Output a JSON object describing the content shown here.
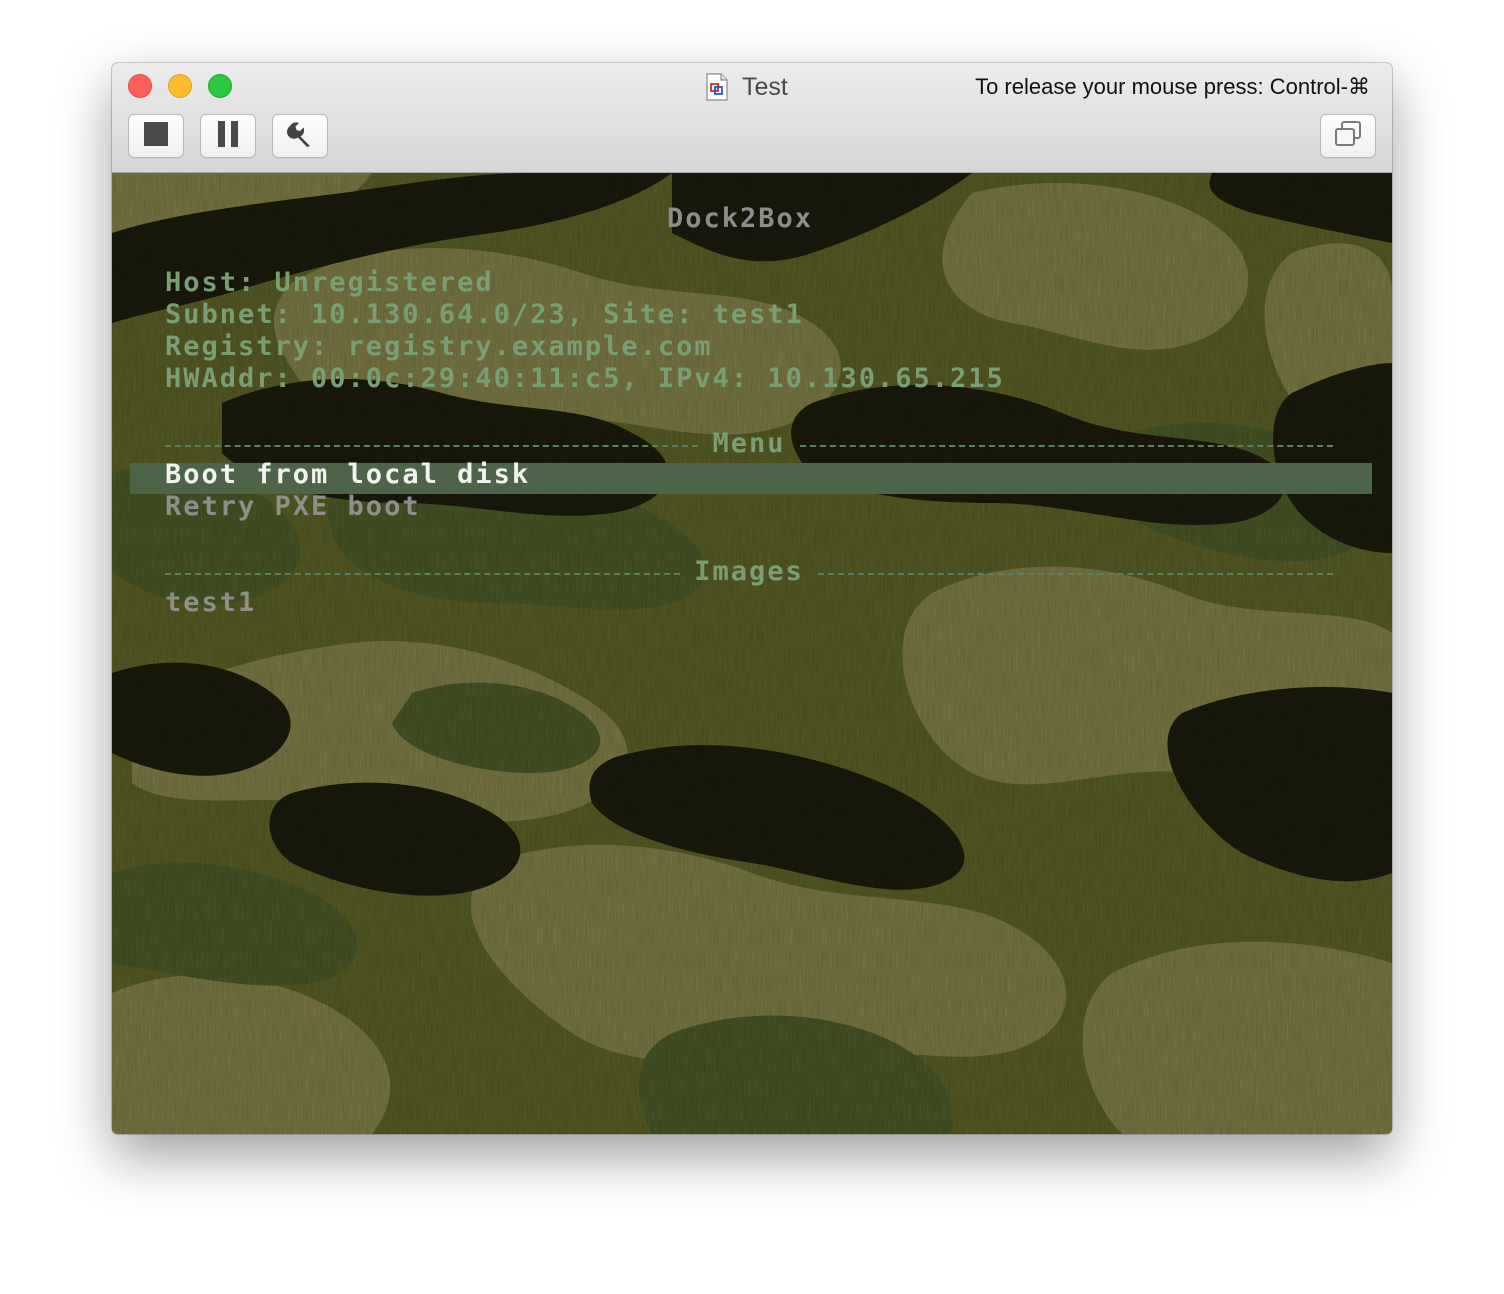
{
  "window": {
    "title": "Test",
    "release_hint": "To release your mouse press: Control-⌘",
    "toolbar": {
      "stop_icon": "stop-icon",
      "pause_icon": "pause-icon",
      "settings_icon": "wrench-icon",
      "window_icon": "window-copy-icon"
    }
  },
  "terminal": {
    "title": "Dock2Box",
    "info": [
      "Host: Unregistered",
      "Subnet: 10.130.64.0/23, Site: test1",
      "Registry: registry.example.com",
      "HWAddr: 00:0c:29:40:11:c5, IPv4: 10.130.65.215"
    ],
    "menu_header": "Menu",
    "menu_items": [
      "Boot from local disk",
      "Retry PXE boot"
    ],
    "images_header": "Images",
    "images": [
      "test1"
    ]
  },
  "colors": {
    "camo_base": "#5d6227",
    "camo_light": "#828149",
    "camo_dark": "#1c1c0d",
    "camo_green": "#4d5b28",
    "text_green": "#7a9e74",
    "highlight_bar": "#4c6448"
  }
}
